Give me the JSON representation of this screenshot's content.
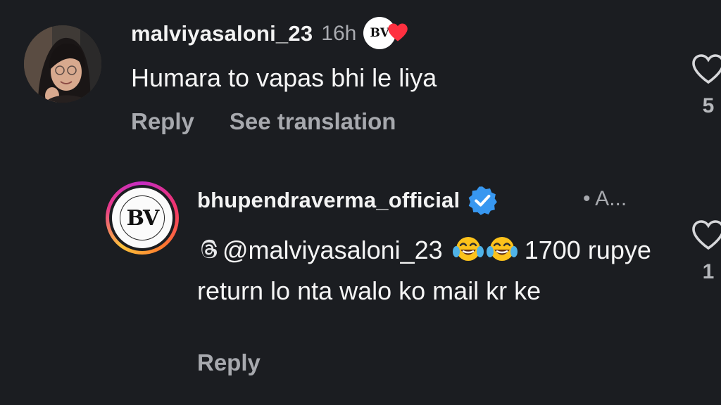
{
  "comment": {
    "username": "malviyasaloni_23",
    "time": "16h",
    "text": "Humara to vapas bhi le liya",
    "actions": {
      "reply": "Reply",
      "translate": "See translation"
    },
    "like_count": "5",
    "liked_by_creator_badge": "BV",
    "heart_color": "#ff3040"
  },
  "reply": {
    "username": "bhupendraverma_official",
    "verified": true,
    "verified_color": "#3797f0",
    "meta": "• A...",
    "mention": "@malviyasaloni_23",
    "emoji": [
      "😂",
      "😂"
    ],
    "text_after": "1700 rupye return lo nta walo ko mail kr ke",
    "avatar_text": "BV",
    "actions": {
      "reply": "Reply"
    },
    "like_count": "1"
  },
  "icons": {
    "like": "heart-outline-icon",
    "verified": "verified-badge-icon",
    "mention": "threads-at-icon"
  }
}
